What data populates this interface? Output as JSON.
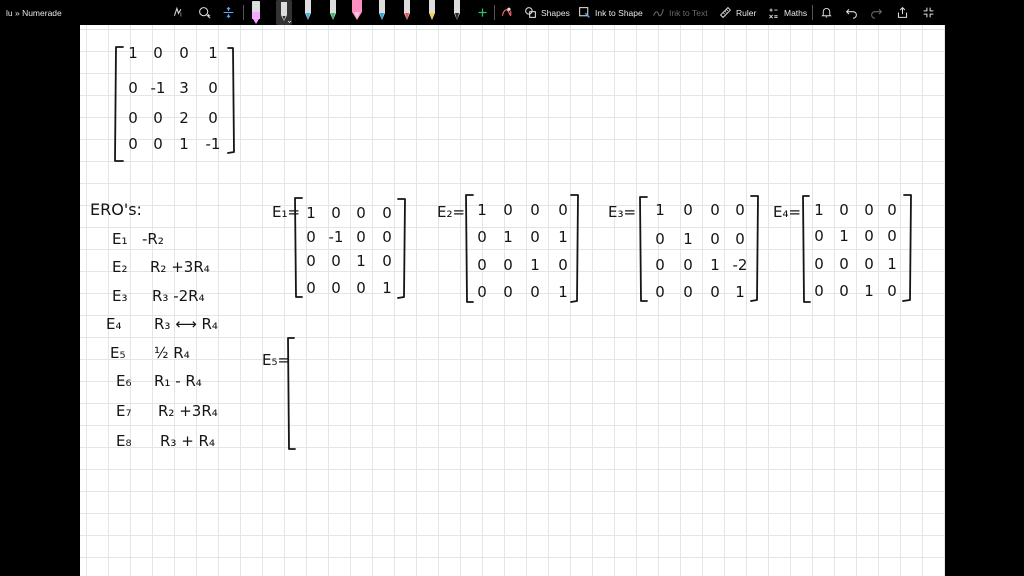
{
  "app": {
    "breadcrumb": "lu » Numerade",
    "tools": {
      "shapes": "Shapes",
      "ink_to_shape": "Ink to Shape",
      "ink_to_text": "Ink to Text",
      "ruler": "Ruler",
      "maths": "Maths"
    },
    "pen_colors": [
      "#2a2a2a",
      "#2a2a2a",
      "#34b4e8",
      "#20c36a",
      "#ff8fc0",
      "#1aa8e6",
      "#ff4a4a",
      "#ffd21a",
      "#2a2a2a"
    ],
    "highlighter_color": "#f5a8ff"
  },
  "matrix_a": {
    "rows": [
      [
        "1",
        "0",
        "0",
        "1"
      ],
      [
        "0",
        "-1",
        "3",
        "0"
      ],
      [
        "0",
        "0",
        "2",
        "0"
      ],
      [
        "0",
        "0",
        "1",
        "-1"
      ]
    ]
  },
  "eros": {
    "heading": "ERO's:",
    "items": [
      {
        "label": "E₁",
        "op": "-R₂"
      },
      {
        "label": "E₂",
        "op": "R₂ +3R₄"
      },
      {
        "label": "E₃",
        "op": "R₃ -2R₄"
      },
      {
        "label": "E₄",
        "op": "R₃ ⟷ R₄"
      },
      {
        "label": "E₅",
        "op": "½ R₄"
      },
      {
        "label": "E₆",
        "op": "R₁ - R₄"
      },
      {
        "label": "E₇",
        "op": "R₂ +3R₄"
      },
      {
        "label": "E₈",
        "op": "R₃ + R₄"
      }
    ]
  },
  "elementary": [
    {
      "label": "E₁=",
      "rows": [
        [
          "1",
          "0",
          "0",
          "0"
        ],
        [
          "0",
          "-1",
          "0",
          "0"
        ],
        [
          "0",
          "0",
          "1",
          "0"
        ],
        [
          "0",
          "0",
          "0",
          "1"
        ]
      ]
    },
    {
      "label": "E₂=",
      "rows": [
        [
          "1",
          "0",
          "0",
          "0"
        ],
        [
          "0",
          "1",
          "0",
          "1"
        ],
        [
          "0",
          "0",
          "1",
          "0"
        ],
        [
          "0",
          "0",
          "0",
          "1"
        ]
      ]
    },
    {
      "label": "E₃=",
      "rows": [
        [
          "1",
          "0",
          "0",
          "0"
        ],
        [
          "0",
          "1",
          "0",
          "0"
        ],
        [
          "0",
          "0",
          "1",
          "-2"
        ],
        [
          "0",
          "0",
          "0",
          "1"
        ]
      ]
    },
    {
      "label": "E₄=",
      "rows": [
        [
          "1",
          "0",
          "0",
          "0"
        ],
        [
          "0",
          "1",
          "0",
          "0"
        ],
        [
          "0",
          "0",
          "0",
          "1"
        ],
        [
          "0",
          "0",
          "1",
          "0"
        ]
      ]
    }
  ],
  "e5": {
    "label": "E₅="
  }
}
